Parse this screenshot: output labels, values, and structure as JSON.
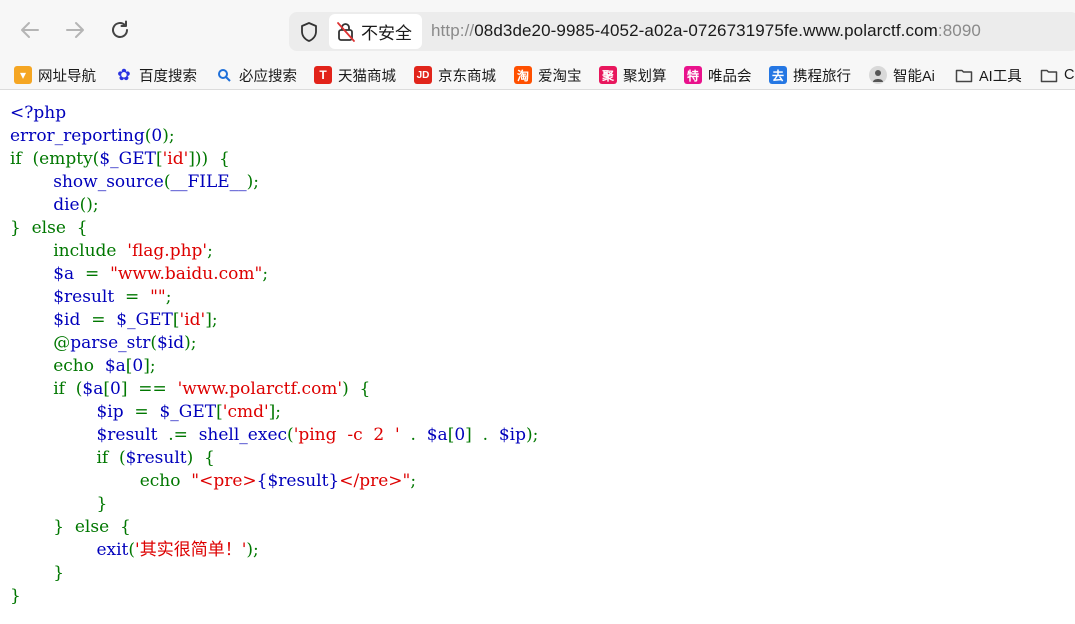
{
  "browser": {
    "back_icon": "back-arrow-icon",
    "forward_icon": "forward-arrow-icon",
    "reload_icon": "reload-icon",
    "shield_icon": "shield-icon",
    "insecure_icon": "insecure-lock-icon",
    "security_label": "不安全",
    "url_prefix": "http://",
    "url_host": "08d3de20-9985-4052-a02a-0726731975fe.www.polarctf.com",
    "url_port": ":8090"
  },
  "bookmarks": [
    {
      "label": "网址导航",
      "icon": "nav-icon",
      "color": "#f5a623"
    },
    {
      "label": "百度搜索",
      "icon": "baidu-paw-icon",
      "color": "#2932e1"
    },
    {
      "label": "必应搜索",
      "icon": "search-icon",
      "color": "#1e6fd9"
    },
    {
      "label": "天猫商城",
      "icon": "tmall-icon",
      "color": "#e2231a"
    },
    {
      "label": "京东商城",
      "icon": "jd-icon",
      "color": "#e1251b"
    },
    {
      "label": "爱淘宝",
      "icon": "taobao-icon",
      "color": "#ff5000"
    },
    {
      "label": "聚划算",
      "icon": "juhuasuan-icon",
      "color": "#e8175d"
    },
    {
      "label": "唯品会",
      "icon": "vip-icon",
      "color": "#e9128c"
    },
    {
      "label": "携程旅行",
      "icon": "ctrip-icon",
      "color": "#2577e3"
    },
    {
      "label": "智能Ai",
      "icon": "ai-avatar-icon",
      "color": "#666666"
    },
    {
      "label": "AI工具",
      "icon": "folder-icon",
      "color": "#444444"
    },
    {
      "label": "C",
      "icon": "folder-icon",
      "color": "#444444"
    }
  ],
  "colors": {
    "keyword": "#007700",
    "default": "#0000bb",
    "string": "#dd0000"
  },
  "code_lines": [
    [
      [
        "b",
        "<?php"
      ]
    ],
    [
      [
        "b",
        "error_reporting"
      ],
      [
        "k",
        "("
      ],
      [
        "b",
        "0"
      ],
      [
        "k",
        ");"
      ]
    ],
    [
      [
        "k",
        "if  (empty("
      ],
      [
        "b",
        "$_GET"
      ],
      [
        "k",
        "["
      ],
      [
        "s",
        "'id'"
      ],
      [
        "k",
        "]))  {"
      ]
    ],
    [
      [
        "k",
        "        "
      ],
      [
        "b",
        "show_source"
      ],
      [
        "k",
        "("
      ],
      [
        "b",
        "__FILE__"
      ],
      [
        "k",
        ");"
      ]
    ],
    [
      [
        "k",
        "        "
      ],
      [
        "b",
        "die"
      ],
      [
        "k",
        "();"
      ]
    ],
    [
      [
        "k",
        "}  else  {"
      ]
    ],
    [
      [
        "k",
        "        include  "
      ],
      [
        "s",
        "'flag.php'"
      ],
      [
        "k",
        ";"
      ]
    ],
    [
      [
        "k",
        "        "
      ],
      [
        "b",
        "$a  "
      ],
      [
        "k",
        "=  "
      ],
      [
        "s",
        "\"www.baidu.com\""
      ],
      [
        "k",
        ";"
      ]
    ],
    [
      [
        "k",
        "        "
      ],
      [
        "b",
        "$result  "
      ],
      [
        "k",
        "=  "
      ],
      [
        "s",
        "\"\""
      ],
      [
        "k",
        ";"
      ]
    ],
    [
      [
        "k",
        "        "
      ],
      [
        "b",
        "$id  "
      ],
      [
        "k",
        "=  "
      ],
      [
        "b",
        "$_GET"
      ],
      [
        "k",
        "["
      ],
      [
        "s",
        "'id'"
      ],
      [
        "k",
        "];"
      ]
    ],
    [
      [
        "k",
        "        @"
      ],
      [
        "b",
        "parse_str"
      ],
      [
        "k",
        "("
      ],
      [
        "b",
        "$id"
      ],
      [
        "k",
        ");"
      ]
    ],
    [
      [
        "k",
        "        echo  "
      ],
      [
        "b",
        "$a"
      ],
      [
        "k",
        "["
      ],
      [
        "b",
        "0"
      ],
      [
        "k",
        "];"
      ]
    ],
    [
      [
        "k",
        "        if  ("
      ],
      [
        "b",
        "$a"
      ],
      [
        "k",
        "["
      ],
      [
        "b",
        "0"
      ],
      [
        "k",
        "]  ==  "
      ],
      [
        "s",
        "'www.polarctf.com'"
      ],
      [
        "k",
        ")  {"
      ]
    ],
    [
      [
        "k",
        "                "
      ],
      [
        "b",
        "$ip  "
      ],
      [
        "k",
        "=  "
      ],
      [
        "b",
        "$_GET"
      ],
      [
        "k",
        "["
      ],
      [
        "s",
        "'cmd'"
      ],
      [
        "k",
        "];"
      ]
    ],
    [
      [
        "k",
        "                "
      ],
      [
        "b",
        "$result  "
      ],
      [
        "k",
        ".=  "
      ],
      [
        "b",
        "shell_exec"
      ],
      [
        "k",
        "("
      ],
      [
        "s",
        "'ping  -c  2  '"
      ],
      [
        "k",
        "  .  "
      ],
      [
        "b",
        "$a"
      ],
      [
        "k",
        "["
      ],
      [
        "b",
        "0"
      ],
      [
        "k",
        "]  .  "
      ],
      [
        "b",
        "$ip"
      ],
      [
        "k",
        ");"
      ]
    ],
    [
      [
        "k",
        "                if  ("
      ],
      [
        "b",
        "$result"
      ],
      [
        "k",
        ")  {"
      ]
    ],
    [
      [
        "k",
        "                        echo  "
      ],
      [
        "s",
        "\"<pre>"
      ],
      [
        "b",
        "{$result}"
      ],
      [
        "s",
        "</pre>\""
      ],
      [
        "k",
        ";"
      ]
    ],
    [
      [
        "k",
        "                }"
      ]
    ],
    [
      [
        "k",
        "        }  else  {"
      ]
    ],
    [
      [
        "k",
        "                "
      ],
      [
        "b",
        "exit"
      ],
      [
        "k",
        "("
      ],
      [
        "s",
        "'其实很简单！'"
      ],
      [
        "k",
        ");"
      ]
    ],
    [
      [
        "k",
        "        }"
      ]
    ],
    [
      [
        "k",
        "}"
      ]
    ]
  ]
}
